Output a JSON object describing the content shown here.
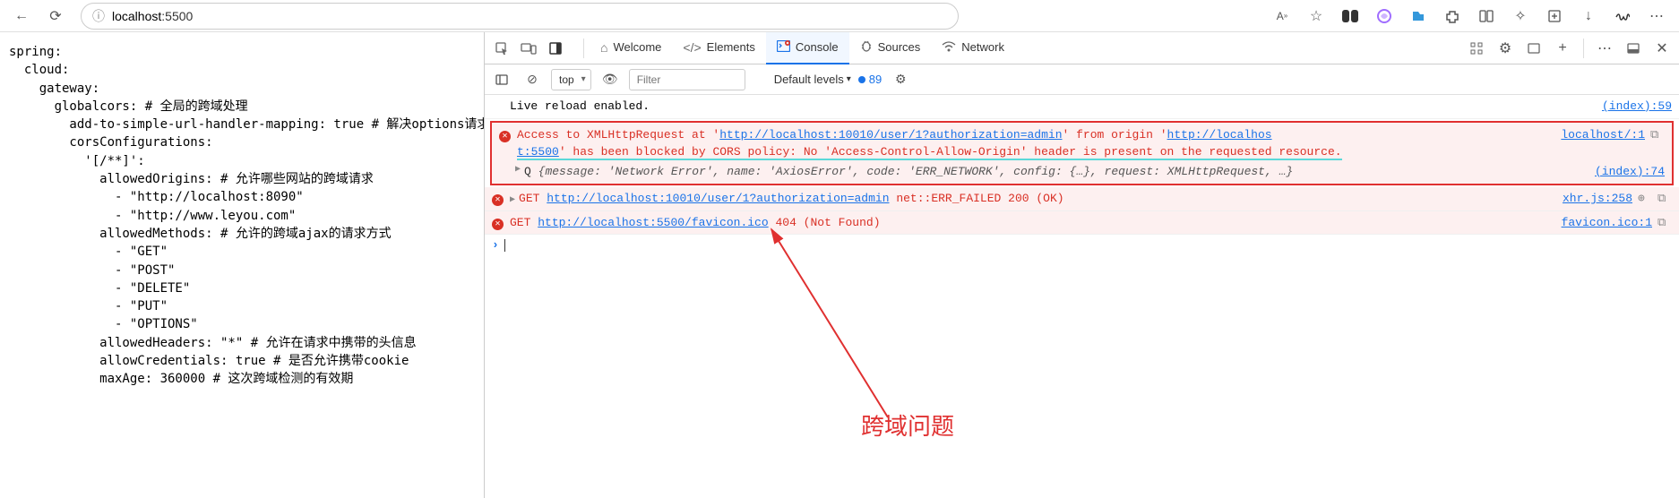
{
  "browser": {
    "url_host": "localhost",
    "url_port": ":5500",
    "reader_label": "A"
  },
  "code": {
    "text": "spring:\n  cloud:\n    gateway:\n      globalcors: # 全局的跨域处理\n        add-to-simple-url-handler-mapping: true # 解决options请求被拦截问题\n        corsConfigurations:\n          '[/**]':\n            allowedOrigins: # 允许哪些网站的跨域请求\n              - \"http://localhost:8090\"\n              - \"http://www.leyou.com\"\n            allowedMethods: # 允许的跨域ajax的请求方式\n              - \"GET\"\n              - \"POST\"\n              - \"DELETE\"\n              - \"PUT\"\n              - \"OPTIONS\"\n            allowedHeaders: \"*\" # 允许在请求中携带的头信息\n            allowCredentials: true # 是否允许携带cookie\n            maxAge: 360000 # 这次跨域检测的有效期"
  },
  "devtools": {
    "tabs": {
      "welcome": "Welcome",
      "elements": "Elements",
      "console": "Console",
      "sources": "Sources",
      "network": "Network"
    },
    "toolbar": {
      "context": "top",
      "filter_placeholder": "Filter",
      "levels": "Default levels",
      "issues": "89"
    },
    "logs": {
      "live_reload": "Live reload enabled.",
      "live_reload_src": "(index):59",
      "cors_pre": "Access to XMLHttpRequest at '",
      "cors_url1": "http://localhost:10010/user/1?authorization=admin",
      "cors_mid": "' from origin '",
      "cors_url2a": "http://localhos",
      "cors_url2b": "t:5500",
      "cors_post": "' has been blocked by CORS policy: No 'Access-Control-Allow-Origin' header is present on the requested resource.",
      "cors_src": "localhost/:1",
      "axios_prefix": "Q",
      "axios_msg": "{message: 'Network Error', name: 'AxiosError', code: 'ERR_NETWORK', config: {…}, request: XMLHttpRequest, …}",
      "axios_src": "(index):74",
      "get_fail_pre": "GET ",
      "get_fail_url": "http://localhost:10010/user/1?authorization=admin",
      "get_fail_post": " net::ERR_FAILED 200 (OK)",
      "get_fail_src": "xhr.js:258",
      "favicon_pre": "GET ",
      "favicon_url": "http://localhost:5500/favicon.ico",
      "favicon_post": " 404 (Not Found)",
      "favicon_src": "favicon.ico:1"
    }
  },
  "annotation": "跨域问题"
}
